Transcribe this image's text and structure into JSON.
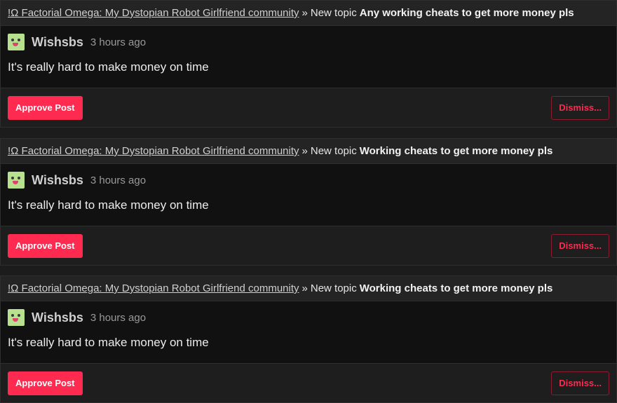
{
  "posts": [
    {
      "community": "!Ω Factorial Omega: My Dystopian Robot Girlfriend community",
      "separator": "»",
      "topic_label": "New topic",
      "topic_title": "Any working cheats to get more money pls",
      "author": "Wishsbs",
      "time": "3 hours ago",
      "body": "It's really hard to make money on time",
      "approve_label": "Approve Post",
      "dismiss_label": "Dismiss..."
    },
    {
      "community": "!Ω Factorial Omega: My Dystopian Robot Girlfriend community",
      "separator": "»",
      "topic_label": "New topic",
      "topic_title": "Working cheats to get more money pls",
      "author": "Wishsbs",
      "time": "3 hours ago",
      "body": "It's really hard to make money on time",
      "approve_label": "Approve Post",
      "dismiss_label": "Dismiss..."
    },
    {
      "community": "!Ω Factorial Omega: My Dystopian Robot Girlfriend community",
      "separator": "»",
      "topic_label": "New topic",
      "topic_title": "Working cheats to get more money pls",
      "author": "Wishsbs",
      "time": "3 hours ago",
      "body": "It's really hard to make money on time",
      "approve_label": "Approve Post",
      "dismiss_label": "Dismiss..."
    }
  ],
  "colors": {
    "accent": "#ff2a50",
    "avatar": "#b7e08f",
    "background": "#1c1c1c",
    "body_background": "#111111"
  },
  "icons": {
    "avatar": "frog-avatar-icon"
  }
}
